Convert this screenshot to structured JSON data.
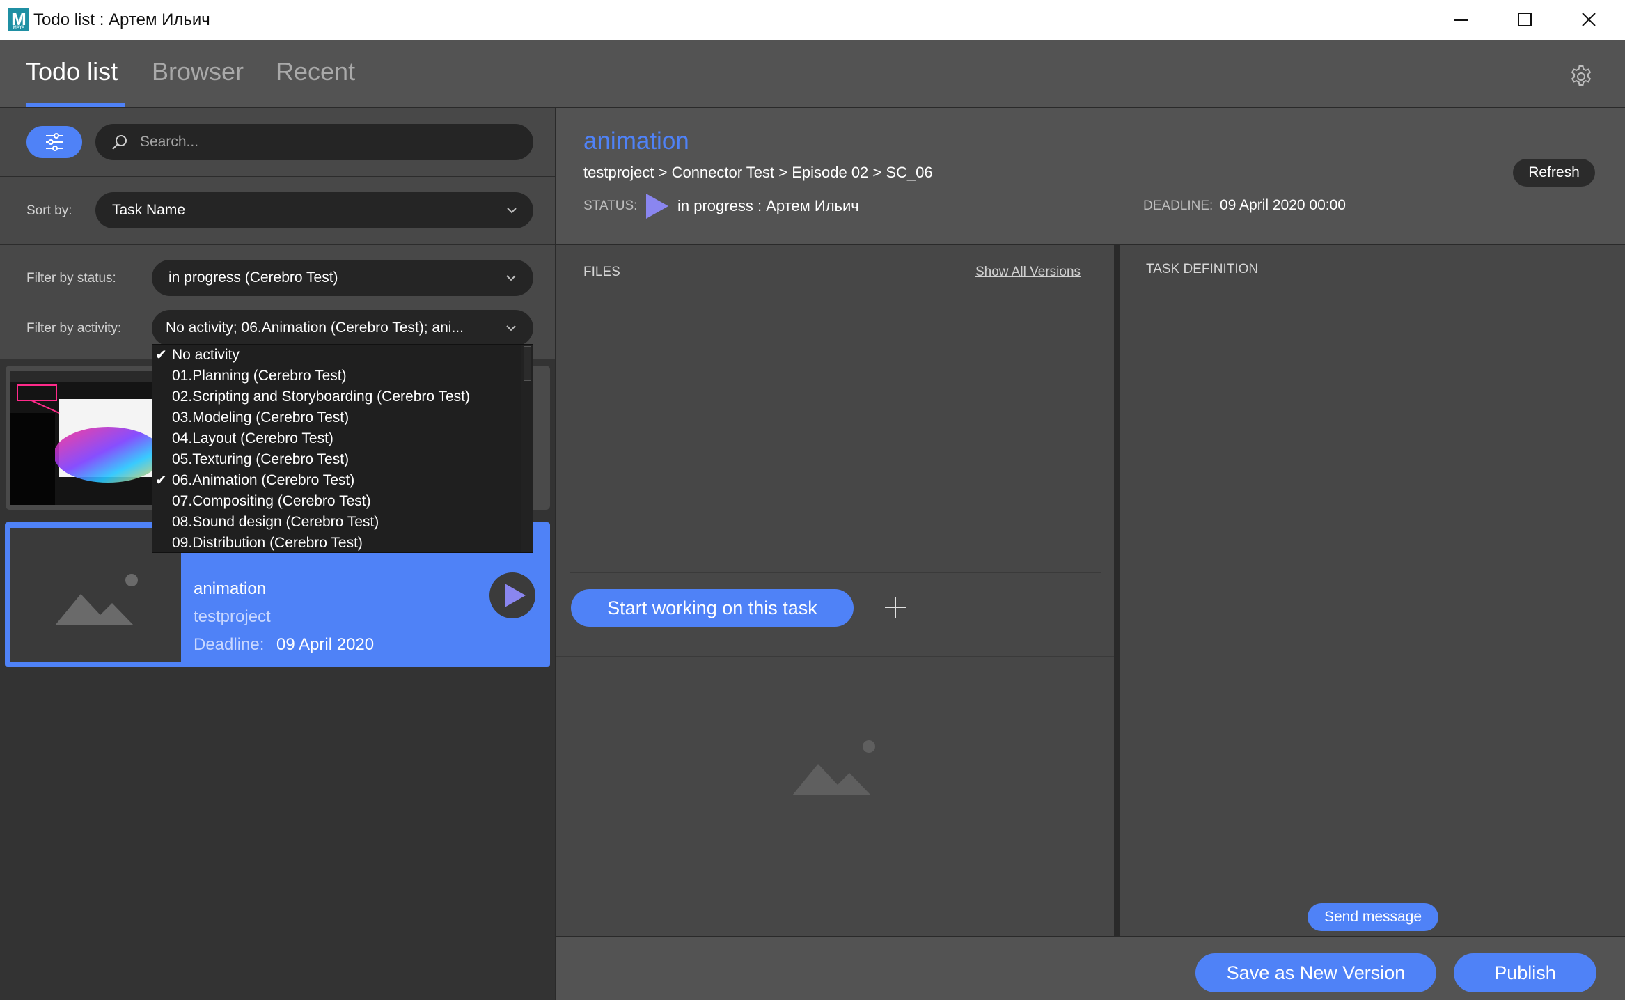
{
  "window": {
    "title": "Todo list : Артем Ильич",
    "logo_letter": "M",
    "logo_sub": "MAYA"
  },
  "tabs": [
    {
      "label": "Todo list",
      "active": true
    },
    {
      "label": "Browser",
      "active": false
    },
    {
      "label": "Recent",
      "active": false
    }
  ],
  "filters": {
    "search_placeholder": "Search...",
    "sort_label": "Sort by:",
    "sort_value": "Task Name",
    "status_label": "Filter by status:",
    "status_value": "in progress (Cerebro Test)",
    "activity_label": "Filter by activity:",
    "activity_value": "No activity; 06.Animation (Cerebro Test); ani..."
  },
  "activity_options": [
    {
      "label": "No activity",
      "checked": true
    },
    {
      "label": "01.Planning (Cerebro Test)",
      "checked": false
    },
    {
      "label": "02.Scripting and Storyboarding (Cerebro Test)",
      "checked": false
    },
    {
      "label": "03.Modeling (Cerebro Test)",
      "checked": false
    },
    {
      "label": "04.Layout (Cerebro Test)",
      "checked": false
    },
    {
      "label": "05.Texturing (Cerebro Test)",
      "checked": false
    },
    {
      "label": "06.Animation (Cerebro Test)",
      "checked": true
    },
    {
      "label": "07.Compositing (Cerebro Test)",
      "checked": false
    },
    {
      "label": "08.Sound design (Cerebro Test)",
      "checked": false
    },
    {
      "label": "09.Distribution (Cerebro Test)",
      "checked": false
    }
  ],
  "tasks": [
    {
      "name": "animation",
      "project": "testproject",
      "deadline_label": "Deadline:",
      "deadline": "09 April 2020",
      "selected": true
    }
  ],
  "detail": {
    "title": "animation",
    "breadcrumb": "testproject > Connector Test > Episode 02 > SC_06",
    "refresh_label": "Refresh",
    "status_label": "STATUS:",
    "status_value": "in progress  : Артем Ильич",
    "deadline_label": "DEADLINE:",
    "deadline_value": "09 April 2020 00:00",
    "files_label": "FILES",
    "show_versions_label": "Show All Versions",
    "start_working_label": "Start working on this task",
    "task_definition_label": "TASK DEFINITION",
    "send_message_label": "Send message"
  },
  "footer": {
    "save_version_label": "Save as New Version",
    "publish_label": "Publish"
  },
  "colors": {
    "accent": "#4f82f7",
    "status_play": "#8a86f0"
  }
}
